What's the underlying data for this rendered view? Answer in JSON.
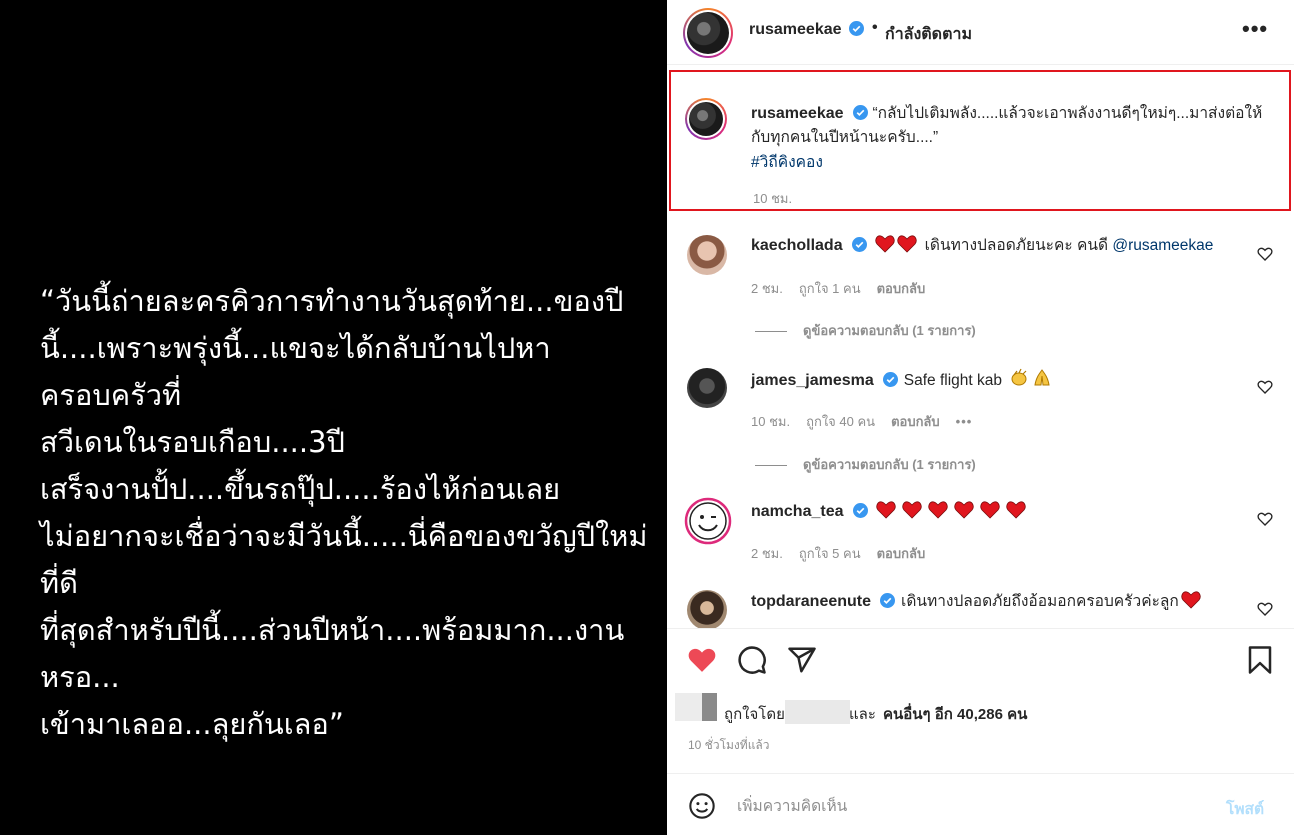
{
  "media": {
    "text": "“วันนี้ถ่ายละครคิวการทำงานวันสุดท้าย...ของปี\nนี้....เพราะพรุ่งนี้...แขจะได้กลับบ้านไปหาครอบครัวที่\nสวีเดนในรอบเกือบ....3ปี\nเสร็จงานปั้ป....ขึ้นรถปุ๊ป.....ร้องไห้ก่อนเลย\nไม่อยากจะเชื่อว่าจะมีวันนี้.....นี่คือของขวัญปีใหม่ที่ดี\nที่สุดสำหรับปีนี้....ส่วนปีหน้า....พร้อมมาก...งานหรอ...\nเข้ามาเลออ...ลุยกันเลอ”"
  },
  "header": {
    "username": "rusameekae",
    "separator": "•",
    "follow_status": "กำลังติดตาม",
    "more": "•••"
  },
  "caption": {
    "username": "rusameekae",
    "text": "“กลับไปเติมพลัง.....แล้วจะเอาพลังงานดีๆใหม่ๆ...มาส่งต่อให้กับทุกคนในปีหน้านะครับ....”",
    "hashtag": "#วิถีคิงคอง",
    "time": "10 ชม."
  },
  "comments": [
    {
      "username": "kaechollada",
      "text": "เดินทางปลอดภัยนะคะ คนดี",
      "mention": "@rusameekae",
      "emojis_before": 2,
      "time": "2 ชม.",
      "likes": "ถูกใจ 1 คน",
      "reply": "ตอบกลับ",
      "view_replies": "ดูข้อความตอบกลับ (1 รายการ)"
    },
    {
      "username": "james_jamesma",
      "text": "Safe flight kab",
      "time": "10 ชม.",
      "likes": "ถูกใจ 40 คน",
      "reply": "ตอบกลับ",
      "more": "•••",
      "view_replies": "ดูข้อความตอบกลับ (1 รายการ)"
    },
    {
      "username": "namcha_tea",
      "hearts": 6,
      "time": "2 ชม.",
      "likes": "ถูกใจ 5 คน",
      "reply": "ตอบกลับ"
    },
    {
      "username": "topdaraneenute",
      "text": "เดินทางปลอดภัยถึงอ้อมอกครอบครัวค่ะลูก"
    }
  ],
  "likes": {
    "prefix": "ถูกใจโดย",
    "and": "และ",
    "others": "คนอื่นๆ อีก 40,286 คน"
  },
  "post_time": "10 ชั่วโมงที่แล้ว",
  "add_comment": {
    "placeholder": "เพิ่มความคิดเห็น",
    "post_label": "โพสต์"
  },
  "colors": {
    "verified": "#3897f0",
    "heart": "#ed4956",
    "highlight_border": "#e0161e",
    "link": "#00376b"
  }
}
